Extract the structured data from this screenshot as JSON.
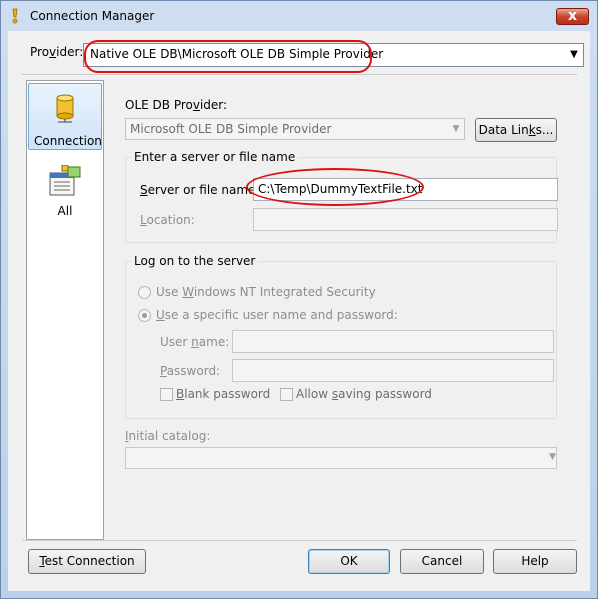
{
  "window": {
    "title": "Connection Manager",
    "close_label": "x"
  },
  "provider": {
    "label_pre": "Pro",
    "label_key": "v",
    "label_post": "ider:",
    "value": "Native OLE DB\\Microsoft OLE DB Simple Provider"
  },
  "nav": {
    "items": [
      {
        "label": "Connection",
        "icon": "database-cylinder-icon",
        "selected": true
      },
      {
        "label": "All",
        "icon": "properties-grid-icon",
        "selected": false
      }
    ]
  },
  "oledb": {
    "label_pre": "OLE DB Pro",
    "label_key": "v",
    "label_post": "ider:",
    "value": "Microsoft OLE DB Simple Provider",
    "data_links_pre": "Data Lin",
    "data_links_key": "k",
    "data_links_post": "s..."
  },
  "server_group": {
    "title": "Enter a server or file name",
    "server_label_pre": "",
    "server_label_key": "S",
    "server_label_post": "erver or file name:",
    "server_value": "C:\\Temp\\DummyTextFile.txt",
    "location_label_key": "L",
    "location_label_post": "ocation:"
  },
  "logon_group": {
    "title": "Log on to the server",
    "radio_nt_pre": "Use ",
    "radio_nt_key": "W",
    "radio_nt_post": "indows NT Integrated Security",
    "radio_specific_key": "U",
    "radio_specific_post": "se a specific user name and password:",
    "username_pre": "User ",
    "username_key": "n",
    "username_post": "ame:",
    "password_key": "P",
    "password_post": "assword:",
    "blank_password_key": "B",
    "blank_password_post": "lank password",
    "allow_saving_pre": "Allow ",
    "allow_saving_key": "s",
    "allow_saving_post": "aving password",
    "selected_option": "specific"
  },
  "catalog": {
    "label_key": "I",
    "label_post": "nitial catalog:"
  },
  "buttons": {
    "test_key": "T",
    "test_post": "est Connection",
    "ok": "OK",
    "cancel": "Cancel",
    "help": "Help"
  },
  "colors": {
    "annotation": "#e01010",
    "title_bar": "#c9d9ec",
    "dialog_bg": "#f0f0f0",
    "close_button": "#c8452d"
  }
}
